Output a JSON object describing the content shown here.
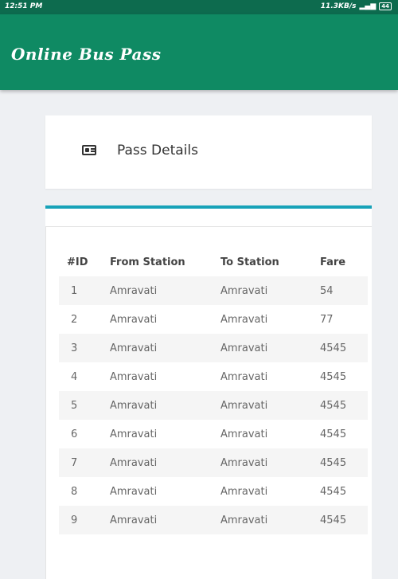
{
  "status_bar": {
    "time": "12:51 PM",
    "network": "11.3KB/s",
    "battery": "44"
  },
  "app_bar": {
    "title": "Online Bus Pass"
  },
  "pass_card": {
    "icon": "id-card-icon",
    "title": "Pass Details"
  },
  "table": {
    "headers": [
      "#ID",
      "From Station",
      "To Station",
      "Fare"
    ],
    "rows": [
      [
        "1",
        "Amravati",
        "Amravati",
        "54"
      ],
      [
        "2",
        "Amravati",
        "Amravati",
        "77"
      ],
      [
        "3",
        "Amravati",
        "Amravati",
        "4545"
      ],
      [
        "4",
        "Amravati",
        "Amravati",
        "4545"
      ],
      [
        "5",
        "Amravati",
        "Amravati",
        "4545"
      ],
      [
        "6",
        "Amravati",
        "Amravati",
        "4545"
      ],
      [
        "7",
        "Amravati",
        "Amravati",
        "4545"
      ],
      [
        "8",
        "Amravati",
        "Amravati",
        "4545"
      ],
      [
        "9",
        "Amravati",
        "Amravati",
        "4545"
      ]
    ]
  },
  "colors": {
    "app_bar": "#0f8a63",
    "status_bar": "#0d6b4e",
    "accent": "#17a2b8"
  }
}
